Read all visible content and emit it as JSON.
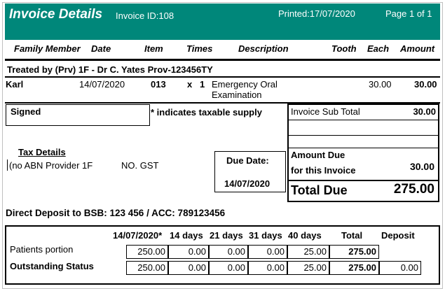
{
  "header": {
    "title": "Invoice Details",
    "invoice_id": "Invoice ID:108",
    "printed": "Printed:17/07/2020",
    "page": "Page 1 of 1",
    "bg_color": "#00877a"
  },
  "columns": [
    "Family Member",
    "Date",
    "Item",
    "Times",
    "Description",
    "Tooth",
    "Each",
    "Amount"
  ],
  "treated_by": "Treated by (Prv) 1F - Dr C. Yates Prov-123456TY",
  "line_items": [
    {
      "member": "Karl",
      "date": "14/07/2020",
      "item": "013",
      "x": "x",
      "times": "1",
      "description_line1": "Emergency Oral",
      "description_line2": "Examination",
      "tooth": "",
      "each": "30.00",
      "amount": "30.00"
    }
  ],
  "signed_label": "Signed",
  "taxable_note": "* indicates taxable supply",
  "tax_details": {
    "heading": "Tax Details",
    "provider": "(no ABN Provider 1F",
    "gst": "NO. GST"
  },
  "due": {
    "label": "Due Date:",
    "date": "14/07/2020"
  },
  "totals": {
    "sub_total_label": "Invoice Sub Total",
    "sub_total": "30.00",
    "amount_due_label1": "Amount Due",
    "amount_due_label2": "for this Invoice",
    "amount_due": "30.00",
    "total_due_label": "Total Due",
    "total_due": "275.00"
  },
  "direct_deposit": "Direct Deposit to BSB: 123 456 / ACC: 789123456",
  "schedule": {
    "headers": [
      "14/07/2020*",
      "14 days",
      "21 days",
      "31 days",
      "40 days",
      "Total",
      "Deposit"
    ],
    "rows": [
      {
        "label": "Patients portion",
        "values": [
          "250.00",
          "0.00",
          "0.00",
          "0.00",
          "25.00",
          "275.00"
        ],
        "deposit": ""
      },
      {
        "label": "Outstanding Status",
        "values": [
          "250.00",
          "0.00",
          "0.00",
          "0.00",
          "25.00",
          "275.00"
        ],
        "deposit": "0.00"
      }
    ]
  }
}
